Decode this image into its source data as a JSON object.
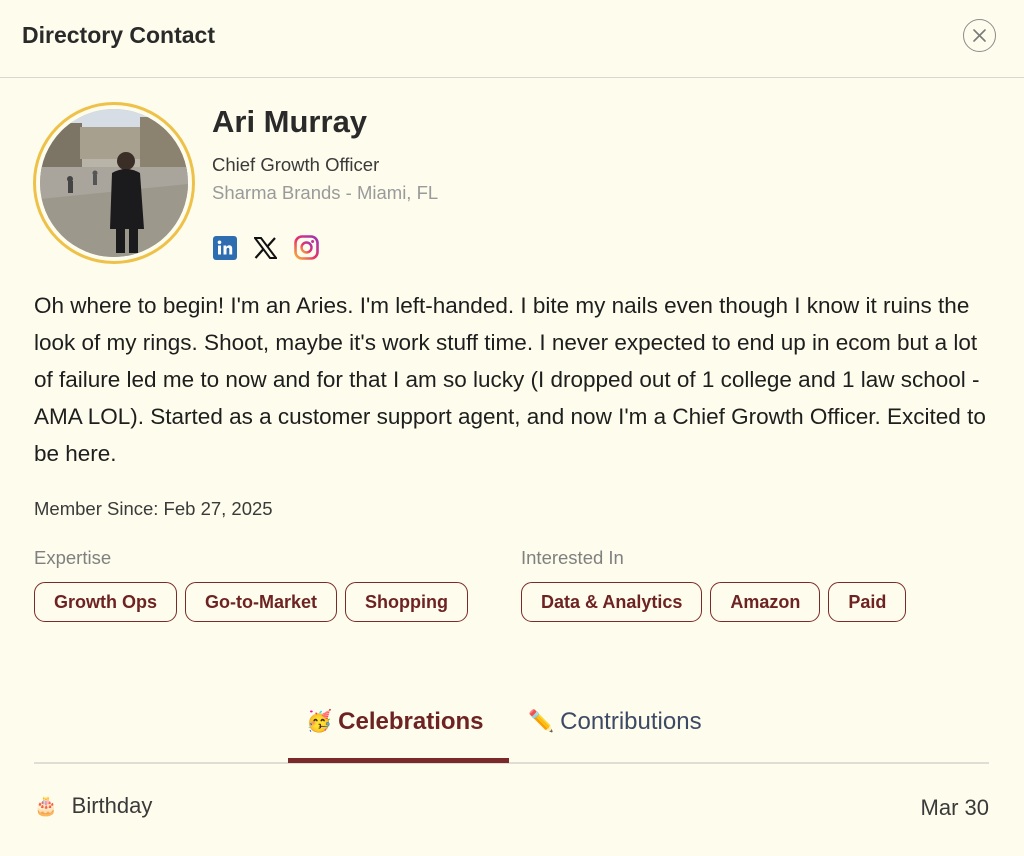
{
  "header": {
    "title": "Directory Contact",
    "close_icon": "close-icon"
  },
  "profile": {
    "name": "Ari Murray",
    "title": "Chief Growth Officer",
    "company_location": "Sharma Brands - Miami, FL",
    "avatar_ring_color": "#eec24a",
    "socials": [
      "linkedin-icon",
      "x-icon",
      "instagram-icon"
    ]
  },
  "bio": "Oh where to begin! I'm an Aries. I'm left-handed. I bite my nails even though I know it ruins the look of my rings. Shoot, maybe it's work stuff time. I never expected to end up in ecom but a lot of failure led me to now and for that I am so lucky (I dropped out of 1 college and 1 law school - AMA LOL). Started as a customer support agent, and now I'm a Chief Growth Officer. Excited to be here.",
  "member_since": "Member Since: Feb 27, 2025",
  "expertise": {
    "label": "Expertise",
    "tags": [
      "Growth Ops",
      "Go-to-Market",
      "Shopping"
    ]
  },
  "interests": {
    "label": "Interested In",
    "tags": [
      "Data & Analytics",
      "Amazon",
      "Paid"
    ]
  },
  "tabs": [
    {
      "emoji": "🥳",
      "label": "Celebrations",
      "active": true,
      "color": "#6e2323"
    },
    {
      "emoji": "✏️",
      "label": "Contributions",
      "active": false,
      "color": "#3d4a66"
    }
  ],
  "celebrations": [
    {
      "emoji": "🎂",
      "label": "Birthday",
      "date": "Mar 30"
    }
  ],
  "colors": {
    "background": "#fefcec",
    "accent": "#7a2a2a",
    "tag_text": "#6e2323"
  }
}
